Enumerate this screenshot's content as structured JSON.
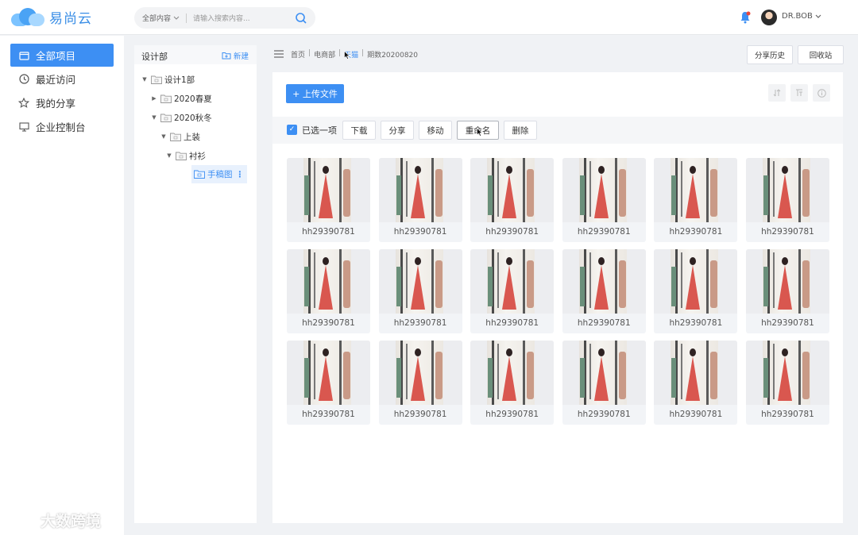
{
  "app": {
    "logo_text": "易尚云"
  },
  "search": {
    "scope": "全部内容",
    "placeholder": "请输入搜索内容..."
  },
  "user": {
    "name": "DR.BOB"
  },
  "nav": {
    "items": [
      {
        "label": "全部项目",
        "icon": "folder-icon",
        "active": true
      },
      {
        "label": "最近访问",
        "icon": "clock-icon"
      },
      {
        "label": "我的分享",
        "icon": "star-icon"
      },
      {
        "label": "企业控制台",
        "icon": "monitor-icon"
      }
    ]
  },
  "tree": {
    "title": "设计部",
    "new_label": "新建",
    "nodes": [
      {
        "label": "设计1部"
      },
      {
        "label": "2020春夏"
      },
      {
        "label": "2020秋冬"
      },
      {
        "label": "上装"
      },
      {
        "label": "衬衫"
      },
      {
        "label": "手稿图"
      }
    ]
  },
  "breadcrumb": {
    "items": [
      "首页",
      "电商部",
      "天猫",
      "期数20200820"
    ]
  },
  "header_buttons": {
    "share_history": "分享历史",
    "recycle_bin": "回收站"
  },
  "toolbar": {
    "upload_label": "+ 上传文件",
    "selected_text": "已选一项",
    "actions": [
      "下载",
      "分享",
      "移动",
      "重命名",
      "删除"
    ]
  },
  "files": [
    "hh29390781",
    "hh29390781",
    "hh29390781",
    "hh29390781",
    "hh29390781",
    "hh29390781",
    "hh29390781",
    "hh29390781",
    "hh29390781",
    "hh29390781",
    "hh29390781",
    "hh29390781",
    "hh29390781",
    "hh29390781",
    "hh29390781",
    "hh29390781",
    "hh29390781",
    "hh29390781"
  ],
  "watermark": {
    "text": "大数跨境"
  },
  "colors": {
    "accent": "#3d8ff3",
    "notify": "#e8463a"
  }
}
